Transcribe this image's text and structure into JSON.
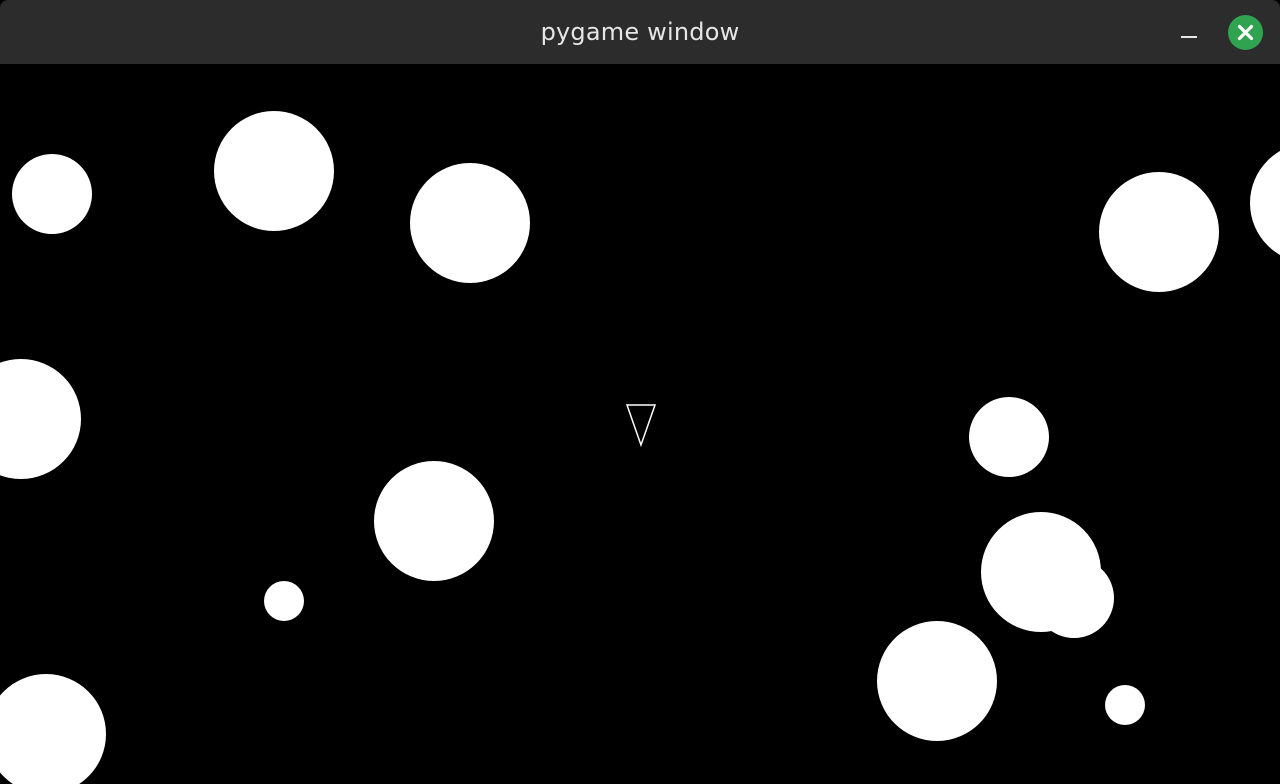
{
  "window": {
    "title": "pygame window",
    "close_button_color": "#2fa34f",
    "titlebar_color": "#2c2c2c"
  },
  "icons": {
    "minimize": "minimize-icon",
    "close": "close-icon"
  },
  "game": {
    "background_color": "#000000",
    "asteroid_color": "#ffffff",
    "ship": {
      "shape": "outlined-triangle",
      "color": "#ffffff",
      "heading": "down"
    }
  }
}
